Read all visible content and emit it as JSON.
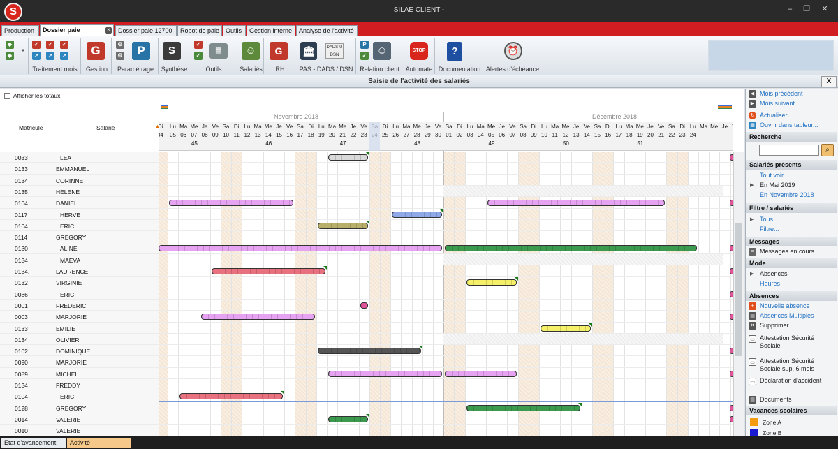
{
  "app": {
    "title": "SILAE CLIENT -",
    "logo": "S"
  },
  "window_controls": [
    "–",
    "❐",
    "✕"
  ],
  "tabs": [
    {
      "label": "Production",
      "active": false
    },
    {
      "label": "Dossier paie",
      "active": true
    },
    {
      "label": "Dossier paie 12700",
      "active": false
    },
    {
      "label": "Robot de paie",
      "active": false
    },
    {
      "label": "Outils",
      "active": false
    },
    {
      "label": "Gestion interne",
      "active": false
    },
    {
      "label": "Analyse de l'activité",
      "active": false
    }
  ],
  "ribbon": {
    "groups": [
      "Traitement mois",
      "Gestion",
      "Paramétrage",
      "Synthèse",
      "Outils",
      "Salariés",
      "RH",
      "PAS - DADS / DSN",
      "Relation client",
      "Automate",
      "Documentation",
      "Alertes d'échéance"
    ],
    "icons": {
      "gestion": "G",
      "parametrage": "P",
      "synthese": "S",
      "rh": "G",
      "dsn": "DADS-U DSN",
      "automate": "STOP",
      "documentation": "?"
    }
  },
  "pane": {
    "title": "Saisie de l'activité des salariés",
    "close": "X"
  },
  "grid": {
    "show_totals": "Afficher les totaux",
    "col_matricule": "Matricule",
    "col_salarie": "Salarié",
    "months": [
      "Novembre 2018",
      "Décembre 2018"
    ],
    "first_day_frag": {
      "name": "Di",
      "num": "04"
    },
    "day_names": [
      "Lu",
      "Ma",
      "Me",
      "Je",
      "Ve",
      "Sa",
      "Di",
      "Lu",
      "Ma",
      "Me",
      "Je",
      "Ve",
      "Sa",
      "Di",
      "Lu",
      "Ma",
      "Me",
      "Je",
      "Ve",
      "Sa",
      "Di",
      "Lu",
      "Ma",
      "Me",
      "Je",
      "Ve",
      "Sa",
      "Di",
      "Lu",
      "Ma",
      "Me",
      "Je",
      "Ve",
      "Sa",
      "Di",
      "Lu",
      "Ma",
      "Me",
      "Je",
      "Ve",
      "Sa",
      "Di",
      "Lu",
      "Ma",
      "Me",
      "Je",
      "Ve",
      "Sa",
      "Di",
      "Lu",
      "Ma",
      "Me",
      "Je",
      "Ve",
      "Sa",
      "Di"
    ],
    "day_nums": [
      "05",
      "06",
      "07",
      "08",
      "09",
      "10",
      "11",
      "12",
      "13",
      "14",
      "15",
      "16",
      "17",
      "18",
      "19",
      "20",
      "21",
      "22",
      "23",
      "24",
      "25",
      "26",
      "27",
      "28",
      "29",
      "30",
      "01",
      "02",
      "03",
      "04",
      "05",
      "06",
      "07",
      "08",
      "09",
      "10",
      "11",
      "12",
      "13",
      "14",
      "15",
      "16",
      "17",
      "18",
      "19",
      "20",
      "21",
      "22",
      "23",
      "24"
    ],
    "last_frag": "L",
    "weeks": [
      "45",
      "46",
      "47",
      "48",
      "49",
      "50",
      "51"
    ],
    "rows": [
      {
        "matricule": "0033",
        "salarie": "LEA"
      },
      {
        "matricule": "0133",
        "salarie": "EMMANUEL"
      },
      {
        "matricule": "0134",
        "salarie": "CORINNE"
      },
      {
        "matricule": "0135",
        "salarie": "HELENE"
      },
      {
        "matricule": "0104",
        "salarie": "DANIEL"
      },
      {
        "matricule": "0117",
        "salarie": "HERVE"
      },
      {
        "matricule": "0104",
        "salarie": "ERIC"
      },
      {
        "matricule": "0114",
        "salarie": "GREGORY"
      },
      {
        "matricule": "0130",
        "salarie": "ALINE"
      },
      {
        "matricule": "0134",
        "salarie": "MAEVA"
      },
      {
        "matricule": "0134.",
        "salarie": "LAURENCE"
      },
      {
        "matricule": "0132",
        "salarie": "VIRGINIE"
      },
      {
        "matricule": "0086",
        "salarie": "ERIC"
      },
      {
        "matricule": "0001",
        "salarie": "FREDERIC"
      },
      {
        "matricule": "0003",
        "salarie": "MARJORIE"
      },
      {
        "matricule": "0133",
        "salarie": "EMILIE"
      },
      {
        "matricule": "0134",
        "salarie": "OLIVIER"
      },
      {
        "matricule": "0102",
        "salarie": "DOMINIQUE"
      },
      {
        "matricule": "0090",
        "salarie": "MARJORIE"
      },
      {
        "matricule": "0089",
        "salarie": "MICHEL"
      },
      {
        "matricule": "0134",
        "salarie": "FREDDY"
      },
      {
        "matricule": "0104",
        "salarie": "ERIC"
      },
      {
        "matricule": "0128",
        "salarie": "GREGORY"
      },
      {
        "matricule": "0014",
        "salarie": "VALERIE"
      },
      {
        "matricule": "0010",
        "salarie": "VALERIE"
      }
    ],
    "absences": [
      {
        "row": 0,
        "start": "2018-11-20",
        "end": "2018-11-23",
        "color": "#d9d9d9",
        "flag": true
      },
      {
        "row": 4,
        "start": "2018-11-05",
        "end": "2018-11-16",
        "color": "#e6a3f2",
        "flag": false
      },
      {
        "row": 4,
        "start": "2018-12-05",
        "end": "2018-12-21",
        "color": "#e6a3f2",
        "flag": false
      },
      {
        "row": 5,
        "start": "2018-11-26",
        "end": "2018-11-30",
        "color": "#8fa8e8",
        "flag": true
      },
      {
        "row": 6,
        "start": "2018-11-19",
        "end": "2018-11-23",
        "color": "#b8b06a",
        "flag": true
      },
      {
        "row": 8,
        "start": "2018-11-04",
        "end": "2018-11-30",
        "color": "#e6a3f2",
        "flag": false
      },
      {
        "row": 8,
        "start": "2018-12-01",
        "end": "2018-12-24",
        "color": "#3c9a4e",
        "flag": false
      },
      {
        "row": 10,
        "start": "2018-11-09",
        "end": "2018-11-19",
        "color": "#e8717f",
        "flag": true
      },
      {
        "row": 11,
        "start": "2018-12-03",
        "end": "2018-12-07",
        "color": "#f4f06a",
        "flag": true
      },
      {
        "row": 13,
        "start": "2018-11-23",
        "end": "2018-11-23",
        "color": "#e0559a",
        "flag": false
      },
      {
        "row": 14,
        "start": "2018-11-08",
        "end": "2018-11-18",
        "color": "#e6a3f2",
        "flag": false
      },
      {
        "row": 15,
        "start": "2018-12-10",
        "end": "2018-12-14",
        "color": "#f4f06a",
        "flag": true
      },
      {
        "row": 17,
        "start": "2018-11-19",
        "end": "2018-11-28",
        "color": "#555555",
        "flag": true
      },
      {
        "row": 19,
        "start": "2018-11-20",
        "end": "2018-11-30",
        "color": "#e6a3f2",
        "flag": false
      },
      {
        "row": 19,
        "start": "2018-12-01",
        "end": "2018-12-07",
        "color": "#e6a3f2",
        "flag": false
      },
      {
        "row": 21,
        "start": "2018-11-06",
        "end": "2018-11-15",
        "color": "#e8717f",
        "flag": true
      },
      {
        "row": 22,
        "start": "2018-12-03",
        "end": "2018-12-13",
        "color": "#3c9a4e",
        "flag": true
      },
      {
        "row": 23,
        "start": "2018-11-20",
        "end": "2018-11-23",
        "color": "#3c9a4e",
        "flag": true
      }
    ]
  },
  "sidebar": {
    "nav": [
      "Mois précédent",
      "Mois suivant"
    ],
    "actions": [
      "Actualiser",
      "Ouvrir dans tableur..."
    ],
    "recherche": {
      "title": "Recherche",
      "value": ""
    },
    "presents": {
      "title": "Salariés présents",
      "items": [
        "Tout voir",
        "En Mai 2019",
        "En Novembre 2018"
      ]
    },
    "filtre": {
      "title": "Filtre / salariés",
      "items": [
        "Tous",
        "Filtre..."
      ]
    },
    "messages": {
      "title": "Messages",
      "items": [
        "Messages en cours"
      ]
    },
    "mode": {
      "title": "Mode",
      "items": [
        "Absences",
        "Heures"
      ]
    },
    "absences": {
      "title": "Absences",
      "items": [
        "Nouvelle absence",
        "Absences Multiples",
        "Supprimer"
      ]
    },
    "docs": [
      "Attestation Sécurité Sociale",
      "Attestation Sécurité Sociale sup. 6 mois",
      "Déclaration d'accident",
      "Documents"
    ],
    "vacances": {
      "title": "Vacances scolaires",
      "zones": [
        {
          "label": "Zone A",
          "color": "#f39c12"
        },
        {
          "label": "Zone B",
          "color": "#1a1ad0"
        }
      ]
    }
  },
  "statusbar": {
    "tabs": [
      "Etat d'avancement",
      "Activité"
    ]
  }
}
